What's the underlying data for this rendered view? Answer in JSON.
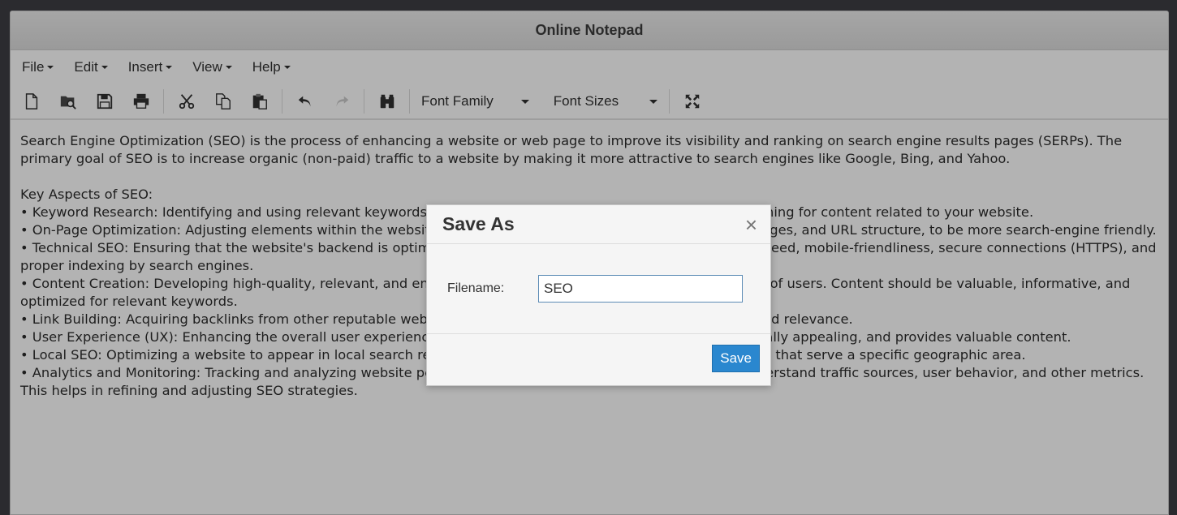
{
  "window": {
    "title": "Online Notepad"
  },
  "menubar": [
    {
      "label": "File"
    },
    {
      "label": "Edit"
    },
    {
      "label": "Insert"
    },
    {
      "label": "View"
    },
    {
      "label": "Help"
    }
  ],
  "toolbar": {
    "icons": [
      "new-file-icon",
      "open-file-icon",
      "save-icon",
      "print-icon",
      "cut-icon",
      "copy-icon",
      "paste-icon",
      "undo-icon",
      "redo-icon",
      "find-icon"
    ],
    "font_family": "Font Family",
    "font_sizes": "Font Sizes",
    "fullscreen": "fullscreen-icon"
  },
  "editor": {
    "text": "Search Engine Optimization (SEO) is the process of enhancing a website or web page to improve its visibility and ranking on search engine results pages (SERPs). The primary goal of SEO is to increase organic (non-paid) traffic to a website by making it more attractive to search engines like Google, Bing, and Yahoo.\n\nKey Aspects of SEO:\n• Keyword Research: Identifying and using relevant keywords and phrases that potential visitors use when searching for content related to your website.\n• On-Page Optimization: Adjusting elements within the website, such as meta tags, titles, headings, content, images, and URL structure, to be more search-engine friendly.\n• Technical SEO: Ensuring that the website's backend is optimized for search engines, including improving site speed, mobile-friendliness, secure connections (HTTPS), and proper indexing by search engines.\n• Content Creation: Developing high-quality, relevant, and engaging content that meets the needs and interests of users. Content should be valuable, informative, and optimized for relevant keywords.\n• Link Building: Acquiring backlinks from other reputable websites to your site to improve your site's authority and relevance.\n• User Experience (UX): Enhancing the overall user experience by ensuring the website is easy to navigate, visually appealing, and provides valuable content.\n• Local SEO: Optimizing a website to appear in local search results, which is particularly important for businesses that serve a specific geographic area.\n• Analytics and Monitoring: Tracking and analyzing website performance using tools like Google Analytics to understand traffic sources, user behavior, and other metrics. This helps in refining and adjusting SEO strategies."
  },
  "dialog": {
    "title": "Save As",
    "close": "×",
    "filename_label": "Filename:",
    "filename_value": "SEO",
    "save_label": "Save"
  }
}
